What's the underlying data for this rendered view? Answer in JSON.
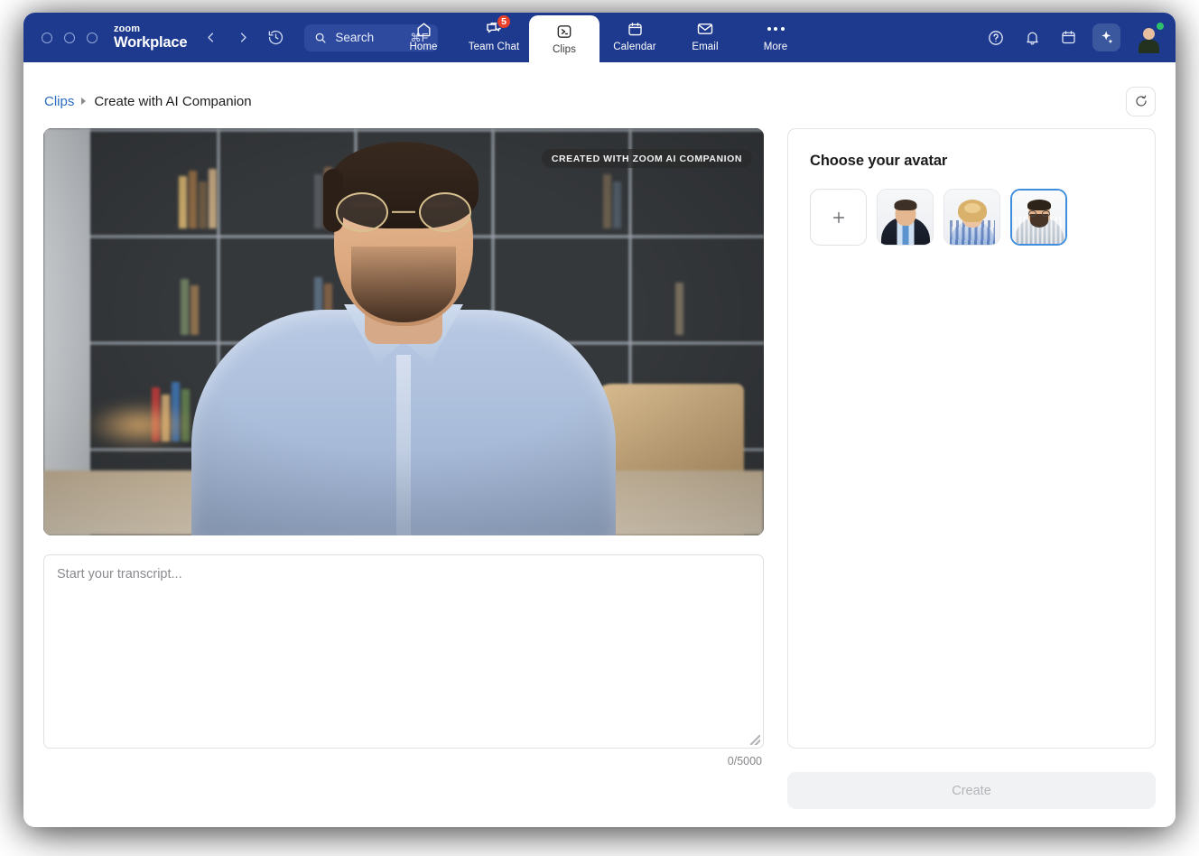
{
  "titlebar": {
    "brand_small": "zoom",
    "brand_main": "Workplace",
    "back_icon": "chevron-left-icon",
    "forward_icon": "chevron-right-icon",
    "history_icon": "clock-history-icon",
    "search": {
      "label": "Search",
      "shortcut": "⌘F",
      "icon": "search-icon"
    },
    "tabs": [
      {
        "label": "Home",
        "icon": "home-icon",
        "active": false,
        "badge": null
      },
      {
        "label": "Team Chat",
        "icon": "chat-icon",
        "active": false,
        "badge": "5"
      },
      {
        "label": "Clips",
        "icon": "clips-icon",
        "active": true,
        "badge": null
      },
      {
        "label": "Calendar",
        "icon": "calendar-icon",
        "active": false,
        "badge": null
      },
      {
        "label": "Email",
        "icon": "envelope-icon",
        "active": false,
        "badge": null
      },
      {
        "label": "More",
        "icon": "more-dots-icon",
        "active": false,
        "badge": null
      }
    ],
    "right_icons": [
      {
        "name": "help-icon"
      },
      {
        "name": "bell-icon"
      },
      {
        "name": "calendar-icon"
      },
      {
        "name": "ai-sparkle-icon"
      }
    ],
    "profile": {
      "name": "profile-avatar",
      "presence": "available"
    },
    "colors": {
      "header_bg": "#1e3a8f",
      "search_bg": "#2d4a9e",
      "badge_red": "#e8402a",
      "presence_green": "#2bc06a",
      "ai_button_bg": "#3b589f"
    }
  },
  "breadcrumb": {
    "parent": "Clips",
    "separator": "▸",
    "current": "Create with AI Companion",
    "refresh_icon": "refresh-icon"
  },
  "video": {
    "badge": "CREATED WITH ZOOM AI COMPANION"
  },
  "transcript": {
    "placeholder": "Start your transcript...",
    "value": "",
    "counter": "0/5000"
  },
  "avatar_panel": {
    "title": "Choose your avatar",
    "add_label": "+",
    "tiles": [
      {
        "name": "add-avatar-tile",
        "kind": "add",
        "selected": false
      },
      {
        "name": "avatar-option-1",
        "kind": "face1",
        "selected": false
      },
      {
        "name": "avatar-option-2",
        "kind": "face2",
        "selected": false
      },
      {
        "name": "avatar-option-3",
        "kind": "face3",
        "selected": true
      }
    ],
    "selected_border_color": "#3f8ede"
  },
  "actions": {
    "create_label": "Create",
    "create_enabled": false
  }
}
